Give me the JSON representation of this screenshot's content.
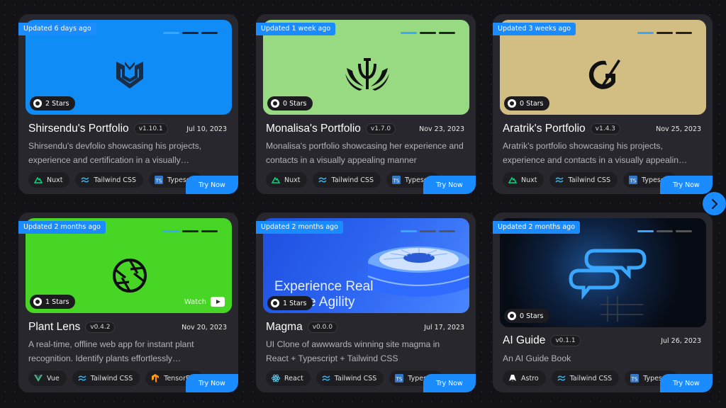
{
  "colors": {
    "accent": "#1a8cff",
    "card_bg": "#27272d",
    "page_bg": "#121217"
  },
  "cards": [
    {
      "updated": "Updated 6 days ago",
      "thumb_color": "#0f8cf5",
      "stars": "2 Stars",
      "title": "Shirsendu's Portfolio",
      "version": "v1.10.1",
      "date": "Jul 10, 2023",
      "description": "Shirsendu's devfolio showcasing his projects, experience and certification in a visually…",
      "tags": [
        "Nuxt",
        "Tailwind CSS",
        "Typescri"
      ],
      "cta": "Try Now"
    },
    {
      "updated": "Updated 1 week ago",
      "thumb_color": "#98da82",
      "stars": "0 Stars",
      "title": "Monalisa's Portfolio",
      "version": "v1.7.0",
      "date": "Nov 23, 2023",
      "description": "Monalisa's portfolio showcasing her experience and contacts in a visually appealing manner",
      "tags": [
        "Nuxt",
        "Tailwind CSS",
        "Typescri"
      ],
      "cta": "Try Now"
    },
    {
      "updated": "Updated 3 weeks ago",
      "thumb_color": "#d2bd83",
      "stars": "0 Stars",
      "title": "Aratrik's Portfolio",
      "version": "v1.4.3",
      "date": "Nov 25, 2023",
      "description": "Aratrik's portfolio showcasing his projects, experience and contacts in a visually appealin…",
      "tags": [
        "Nuxt",
        "Tailwind CSS",
        "Typescri"
      ],
      "cta": "Try Now"
    },
    {
      "updated": "Updated 2 months ago",
      "thumb_color": "#47d625",
      "stars": "1 Stars",
      "watch": "Watch",
      "title": "Plant Lens",
      "version": "v0.4.2",
      "date": "Nov 20, 2023",
      "description": "A real-time, offline web app for instant plant recognition. Identify plants effortlessly…",
      "tags": [
        "Vue",
        "Tailwind CSS",
        "TensorFlo"
      ],
      "cta": "Try Now"
    },
    {
      "updated": "Updated 2 months ago",
      "thumb_color": "#1f56e6",
      "thumb_text_1": "Experience Real",
      "thumb_text_2": "e Agility",
      "stars": "1 Stars",
      "title": "Magma",
      "version": "v0.0.0",
      "date": "Jul 17, 2023",
      "description": "UI Clone of awwwards winning site magma in React + Typescript + Tailwind CSS",
      "tags": [
        "React",
        "Tailwind CSS",
        "Typescri"
      ],
      "cta": "Try Now"
    },
    {
      "updated": "Updated 2 months ago",
      "thumb_color": "#0a0f1a",
      "stars": "0 Stars",
      "title": "AI Guide",
      "version": "v0.1.1",
      "date": "Jul 26, 2023",
      "description": "An AI Guide Book",
      "tags": [
        "Astro",
        "Tailwind CSS",
        "Typescri"
      ],
      "cta": "Try Now"
    }
  ],
  "icons": {
    "next": "chevron-right-icon",
    "github": "github-icon",
    "youtube": "youtube-icon"
  }
}
